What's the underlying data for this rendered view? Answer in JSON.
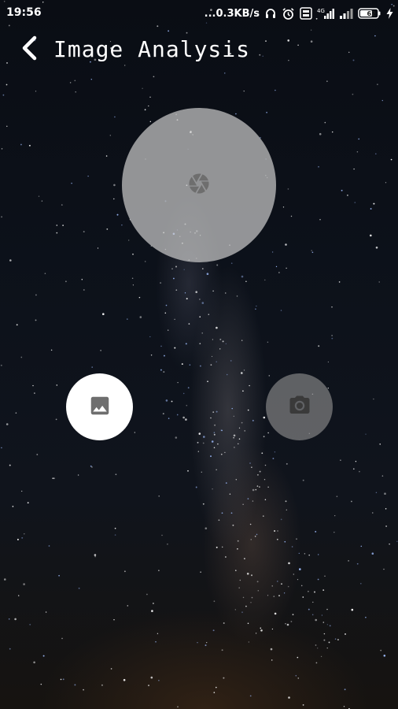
{
  "status_bar": {
    "time": "19:56",
    "net_speed": "...0.3KB/s",
    "battery_level": "62",
    "icons": [
      "headset-icon",
      "alarm-icon",
      "volte-icon",
      "signal-4g-icon",
      "signal-icon",
      "battery-icon",
      "charging-icon"
    ]
  },
  "header": {
    "title": "Image Analysis",
    "back_icon": "chevron-left-icon"
  },
  "buttons": {
    "capture_icon": "shutter-icon",
    "gallery_icon": "image-icon",
    "camera_icon": "camera-icon"
  },
  "colors": {
    "background": "#0b0f16",
    "capture_fill": "#c8c8c8",
    "gallery_fill": "#ffffff",
    "camera_fill": "#969696",
    "icon_gray": "#6e6e6e"
  }
}
